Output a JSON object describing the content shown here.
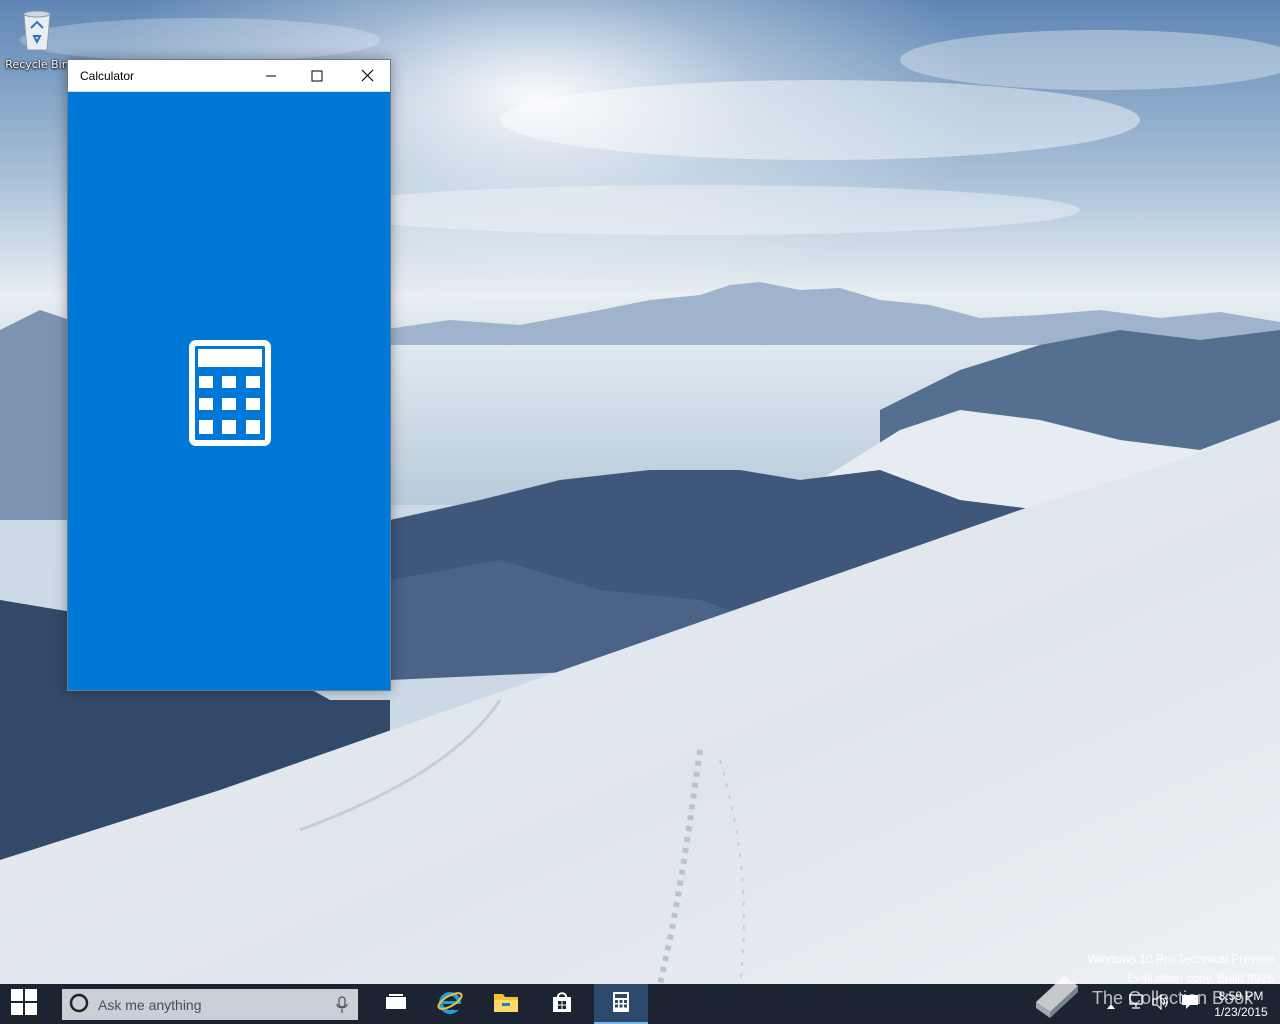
{
  "desktop": {
    "icons": [
      {
        "label": "Recycle Bin",
        "icon": "recycle-bin-icon"
      }
    ]
  },
  "window": {
    "title": "Calculator",
    "controls": {
      "minimize": "minimize-icon",
      "maximize": "maximize-icon",
      "close": "close-icon"
    },
    "splash_icon": "calculator-icon",
    "accent_color": "#0078d7"
  },
  "watermark": {
    "line1": "Windows 10 Pro Technical Preview",
    "line2": "Evaluation copy. Build 9926"
  },
  "branding": {
    "text": "The Collection Book"
  },
  "taskbar": {
    "start_icon": "windows-logo-icon",
    "search": {
      "placeholder": "Ask me anything",
      "icon": "cortana-icon",
      "mic_icon": "microphone-icon"
    },
    "pinned": [
      {
        "name": "Task View",
        "icon": "task-view-icon"
      },
      {
        "name": "Internet Explorer",
        "icon": "internet-explorer-icon"
      },
      {
        "name": "File Explorer",
        "icon": "folder-icon"
      },
      {
        "name": "Store",
        "icon": "store-icon"
      },
      {
        "name": "Calculator",
        "icon": "calculator-icon",
        "active": true
      }
    ],
    "tray": {
      "icons": [
        "chevron-up-icon",
        "network-icon",
        "volume-icon",
        "notification-icon"
      ]
    },
    "clock": {
      "time": "8:59 PM",
      "date": "1/23/2015"
    }
  }
}
